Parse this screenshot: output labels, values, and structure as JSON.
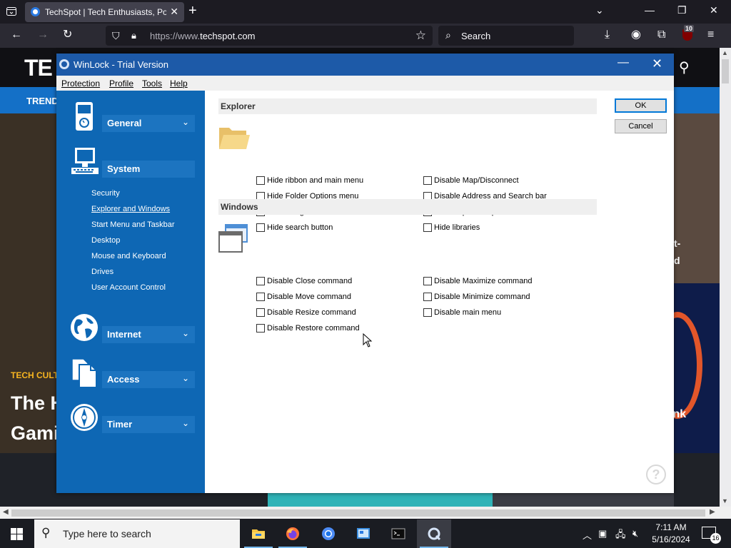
{
  "browser": {
    "tab_title": "TechSpot | Tech Enthusiasts, Power Users, Gamers",
    "url_prefix": "https://www.",
    "url_host": "techspot.com",
    "search_placeholder": "Search",
    "ublock_badge": "10"
  },
  "webpage": {
    "logo": "TE",
    "nav_trending": "TREND",
    "hero_tag": "TECH CULT",
    "hero_line1": "The H",
    "hero_line2": "Gami",
    "right_text1": "t-",
    "right_text2": "d",
    "right_text3": "ink"
  },
  "dialog": {
    "title": "WinLock - Trial Version",
    "menu": [
      "Protection",
      "Profile",
      "Tools",
      "Help"
    ],
    "categories": {
      "general": "General",
      "system": "System",
      "internet": "Internet",
      "access": "Access",
      "timer": "Timer"
    },
    "system_items": [
      "Security",
      "Explorer and Windows",
      "Start Menu and Taskbar",
      "Desktop",
      "Mouse and Keyboard",
      "Drives",
      "User Account Control"
    ],
    "active_item": "Explorer and Windows",
    "explorer": {
      "header": "Explorer",
      "left": [
        "Hide ribbon and main menu",
        "Hide Folder Options menu",
        "Disable right-click menu",
        "Hide search button"
      ],
      "right": [
        "Disable Map/Disconnect",
        "Disable Address and Search bar",
        "Disable preview pane",
        "Hide libraries"
      ]
    },
    "windows": {
      "header": "Windows",
      "left": [
        "Disable Close command",
        "Disable Move command",
        "Disable Resize command",
        "Disable Restore command"
      ],
      "right": [
        "Disable Maximize command",
        "Disable Minimize command",
        "Disable main menu"
      ]
    },
    "ok_label": "OK",
    "cancel_label": "Cancel",
    "help_symbol": "?"
  },
  "taskbar": {
    "search_placeholder": "Type here to search",
    "time": "7:11 AM",
    "date": "5/16/2024",
    "notification_count": "16"
  },
  "colors": {
    "dialog_title": "#1d5aa8",
    "sidebar": "#0e67b4",
    "ok_border": "#0078d7"
  }
}
